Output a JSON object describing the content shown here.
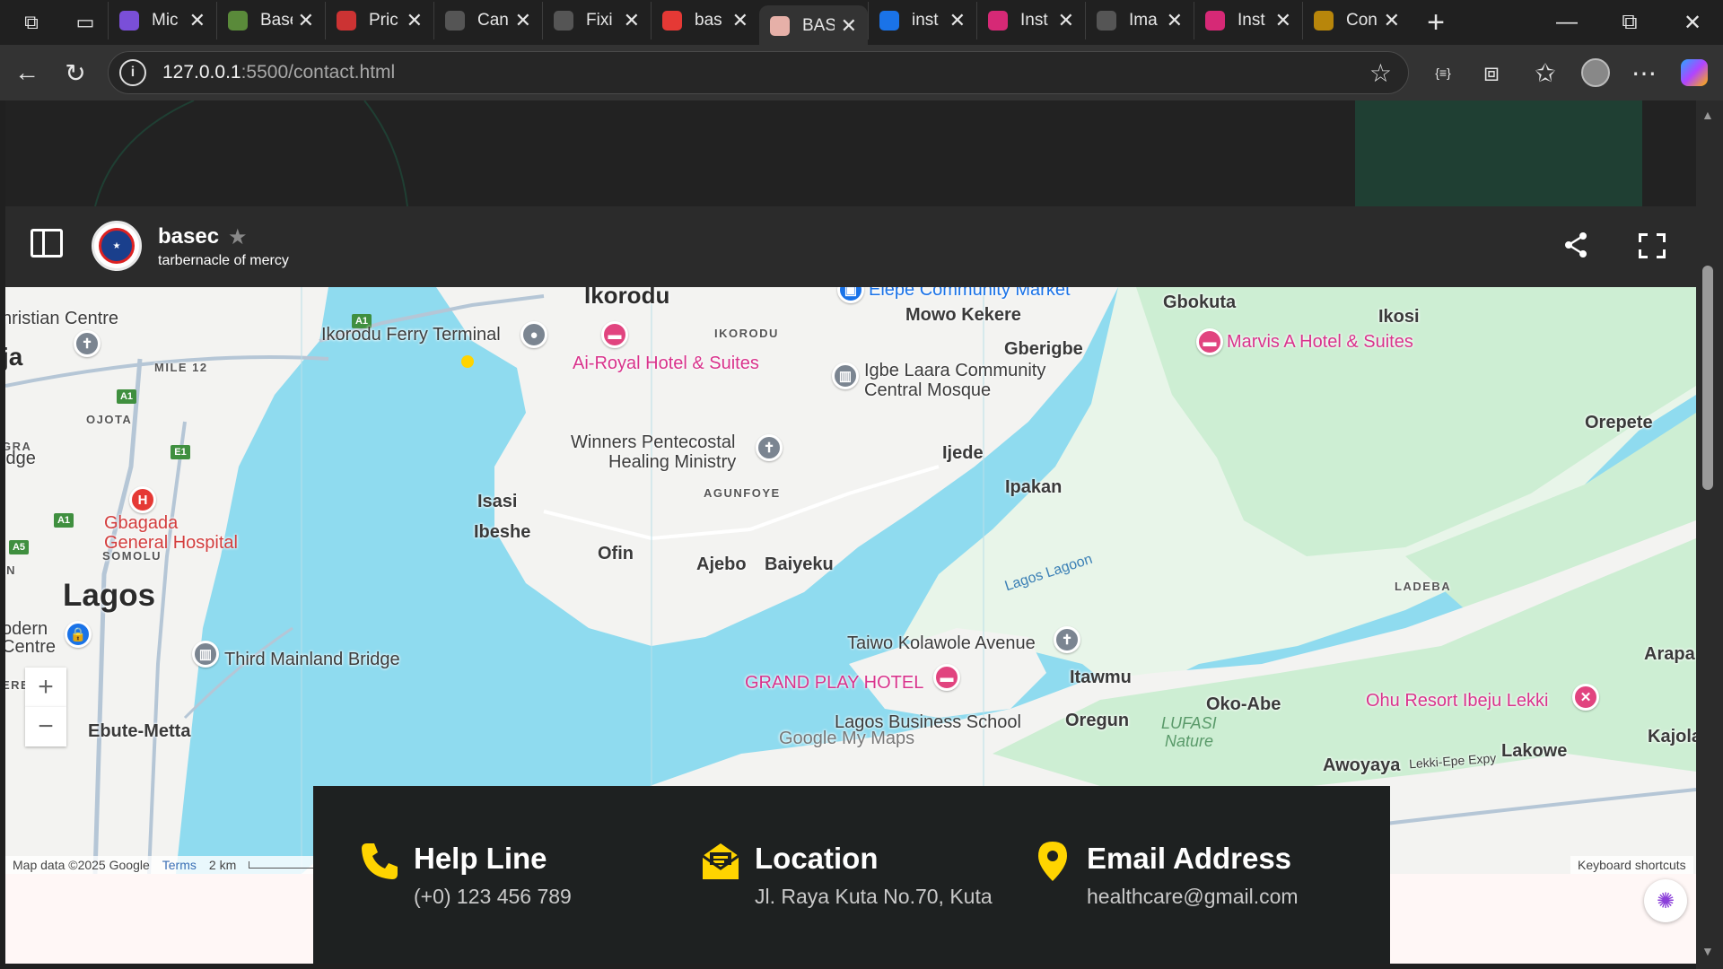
{
  "browser": {
    "tabs": [
      {
        "label": "Mic",
        "favicon": "copilot-icon",
        "color": "#7a4fd8"
      },
      {
        "label": "Base",
        "favicon": "shopify-icon",
        "color": "#5a8a3a"
      },
      {
        "label": "Pric",
        "favicon": "pdf-icon",
        "color": "#c33"
      },
      {
        "label": "Can",
        "favicon": "slash-icon",
        "color": "#555"
      },
      {
        "label": "Fixi",
        "favicon": "openai-icon",
        "color": "#555"
      },
      {
        "label": "bas",
        "favicon": "maps-pin-icon",
        "color": "#e53935"
      },
      {
        "label": "BAS",
        "favicon": "puzzle-icon",
        "color": "#e6b0a8",
        "active": true
      },
      {
        "label": "inst",
        "favicon": "search-icon",
        "color": "#1a73e8"
      },
      {
        "label": "Inst",
        "favicon": "instagram-icon",
        "color": "#d62976"
      },
      {
        "label": "Ima",
        "favicon": "slash-icon",
        "color": "#555"
      },
      {
        "label": "Inst",
        "favicon": "instagram-icon",
        "color": "#d62976"
      },
      {
        "label": "Con",
        "favicon": "gear-icon",
        "color": "#b8860b"
      }
    ],
    "url_host": "127.0.0.1",
    "url_path": ":5500/contact.html"
  },
  "map_header": {
    "title": "basec",
    "subtitle": "tarbernacle of mercy"
  },
  "map": {
    "places": {
      "ikorodu": "Ikorodu",
      "elepe_market": "Elepe Community Market",
      "mowo_kekere": "Mowo Kekere",
      "gbokuta": "Gbokuta",
      "ikosi": "Ikosi",
      "christian_centre": "hristian Centre",
      "eja": "ja",
      "mile12": "MILE 12",
      "ferry_terminal": "Ikorodu Ferry Terminal",
      "ikorodu_small": "IKORODU",
      "gberigbe": "Gberigbe",
      "marvis_hotel": "Marvis A Hotel & Suites",
      "ai_royal": "Ai-Royal Hotel & Suites",
      "igbe_laara_1": "Igbe Laara Community",
      "igbe_laara_2": "Central Mosque",
      "ojota": "OJOTA",
      "gra": "GRA",
      "orepete": "Orepete",
      "winners_1": "Winners Pentecostal",
      "winners_2": "Healing Ministry",
      "ijede": "Ijede",
      "idge": "idge",
      "agunfoye": "AGUNFOYE",
      "ipakan": "Ipakan",
      "isasi": "Isasi",
      "gbagada_1": "Gbagada",
      "gbagada_2": "General Hospital",
      "ibeshe": "Ibeshe",
      "ofin": "Ofin",
      "somolu": "SOMOLU",
      "ajebo": "Ajebo",
      "baiyeku": "Baiyeku",
      "in": "IN",
      "lagos_lagoon": "Lagos Lagoon",
      "ladeba": "LADEBA",
      "lagos": "Lagos",
      "odern_1": "odern",
      "odern_2": "Centre",
      "taiwo": "Taiwo Kolawole Avenue",
      "third_mainland": "Third Mainland Bridge",
      "arapa": "Arapa",
      "itawmu": "Itawmu",
      "grand_play": "GRAND PLAY HOTEL",
      "ere": "ERE",
      "oko_abe": "Oko-Abe",
      "ibeju_resort": "Ohu Resort Ibeju Lekki",
      "lagos_school": "Lagos Business School",
      "lufasi": "LUFASI",
      "nature": "Nature",
      "ebute_metta": "Ebute-Metta",
      "oregun": "Oregun",
      "kajola": "Kajola",
      "lakowe": "Lakowe",
      "awoyaya": "Awoyaya",
      "lekki_epe": "Lekki-Epe Expy",
      "google": "Google My Maps"
    },
    "shields": [
      "A1",
      "A1",
      "E1",
      "A1",
      "A5",
      "A1"
    ],
    "zoom_in": "+",
    "zoom_out": "−",
    "attribution": "Map data ©2025 Google",
    "terms": "Terms",
    "scale": "2 km",
    "shortcuts": "Keyboard shortcuts"
  },
  "contact": {
    "help_title": "Help Line",
    "help_text": "(+0) 123 456 789",
    "location_title": "Location",
    "location_text": "Jl. Raya Kuta No.70, Kuta",
    "email_title": "Email Address",
    "email_text": "healthcare@gmail.com"
  },
  "colors": {
    "accent_yellow": "#ffd400",
    "water": "#8fdbef",
    "land": "#f3f3f1",
    "park": "#cdeed3",
    "contact_bg": "#1e2121"
  }
}
